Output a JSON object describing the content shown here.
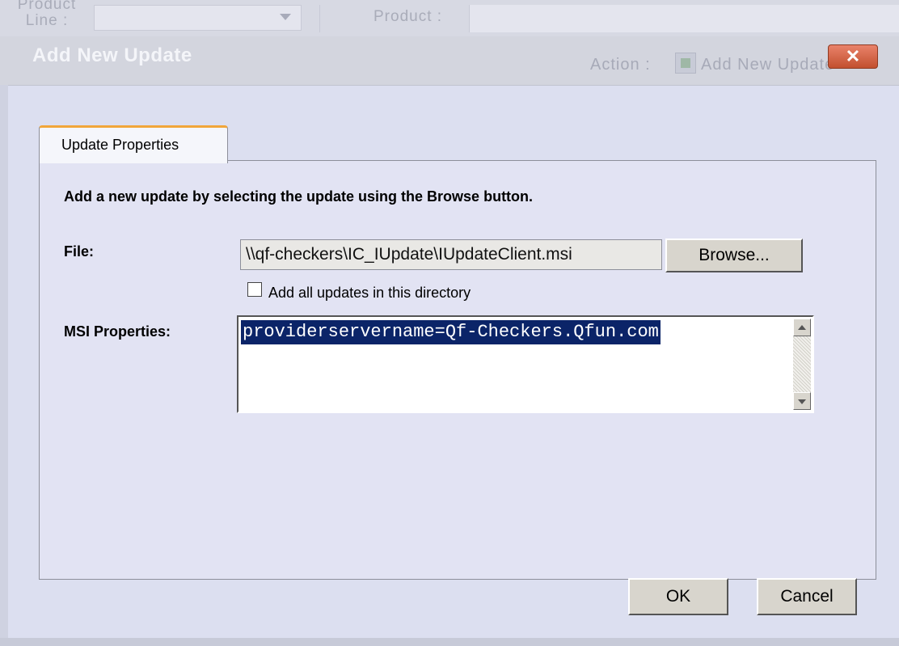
{
  "background": {
    "product_line_label": "Product Line :",
    "product_label": "Product :"
  },
  "dialog": {
    "title": "Add New Update",
    "action_label": "Action :",
    "action_value": "Add New Update",
    "close_icon": "close-x-icon",
    "close_glyph": "✕"
  },
  "tabs": [
    {
      "label": "Update Properties",
      "active": true
    }
  ],
  "form": {
    "instruction": "Add a new update by selecting the update using the Browse button.",
    "file_label": "File:",
    "file_value": "\\\\qf-checkers\\IC_IUpdate\\IUpdateClient.msi",
    "browse_label": "Browse...",
    "add_all_label": "Add all updates in this directory",
    "add_all_checked": false,
    "msi_label": "MSI Properties:",
    "msi_value": "providerservername=Qf-Checkers.Qfun.com"
  },
  "footer": {
    "ok_label": "OK",
    "cancel_label": "Cancel"
  },
  "colors": {
    "tab_accent": "#f1a63a",
    "selection_highlight": "#0b2468",
    "close_button": "#c2502f"
  }
}
